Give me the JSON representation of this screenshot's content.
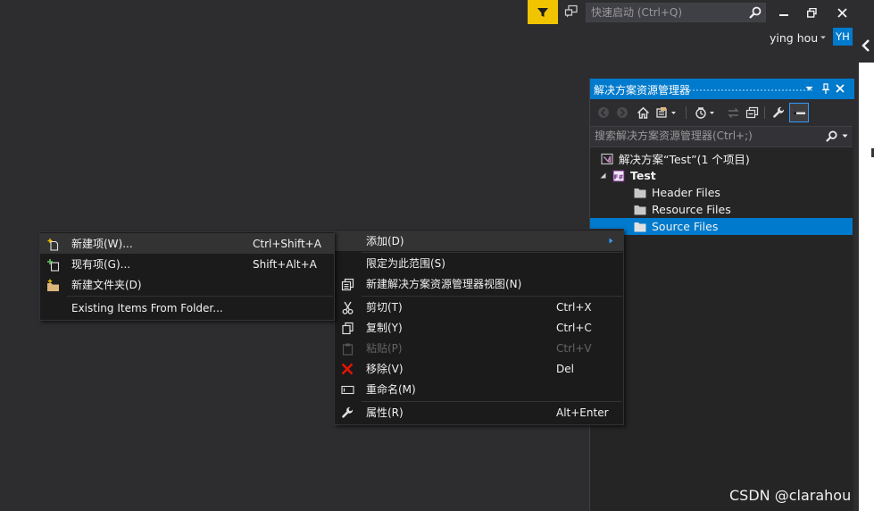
{
  "titlebar": {
    "quick_launch_placeholder": "快速启动 (Ctrl+Q)",
    "user_name": "ying hou",
    "avatar_initials": "YH"
  },
  "solution_explorer": {
    "title": "解决方案资源管理器",
    "search_placeholder": "搜索解决方案资源管理器(Ctrl+;)",
    "tree": [
      {
        "label": "解决方案“Test”(1 个项目)",
        "icon": "solution-icon"
      },
      {
        "label": "Test",
        "icon": "project-icon"
      },
      {
        "label": "Header Files",
        "icon": "folder-icon"
      },
      {
        "label": "Resource Files",
        "icon": "folder-icon"
      },
      {
        "label": "Source Files",
        "icon": "folder-icon",
        "selected": true
      }
    ]
  },
  "context_menu": {
    "items": [
      {
        "label": "添加(D)",
        "has_submenu": true
      },
      {
        "label": "限定为此范围(S)"
      },
      {
        "label": "新建解决方案资源管理器视图(N)"
      },
      {
        "label": "剪切(T)",
        "shortcut": "Ctrl+X"
      },
      {
        "label": "复制(Y)",
        "shortcut": "Ctrl+C"
      },
      {
        "label": "粘贴(P)",
        "shortcut": "Ctrl+V",
        "disabled": true
      },
      {
        "label": "移除(V)",
        "shortcut": "Del"
      },
      {
        "label": "重命名(M)"
      },
      {
        "label": "属性(R)",
        "shortcut": "Alt+Enter"
      }
    ]
  },
  "submenu": {
    "items": [
      {
        "label": "新建项(W)...",
        "shortcut": "Ctrl+Shift+A"
      },
      {
        "label": "现有项(G)...",
        "shortcut": "Shift+Alt+A"
      },
      {
        "label": "新建文件夹(D)"
      },
      {
        "label": "Existing Items From Folder..."
      }
    ]
  },
  "watermark": "CSDN @clarahou",
  "colors": {
    "accent": "#007acc",
    "background": "#2d2d30",
    "menu_bg": "#1b1b1c",
    "filter_button": "#f0c400",
    "remove_icon": "#e51400"
  }
}
